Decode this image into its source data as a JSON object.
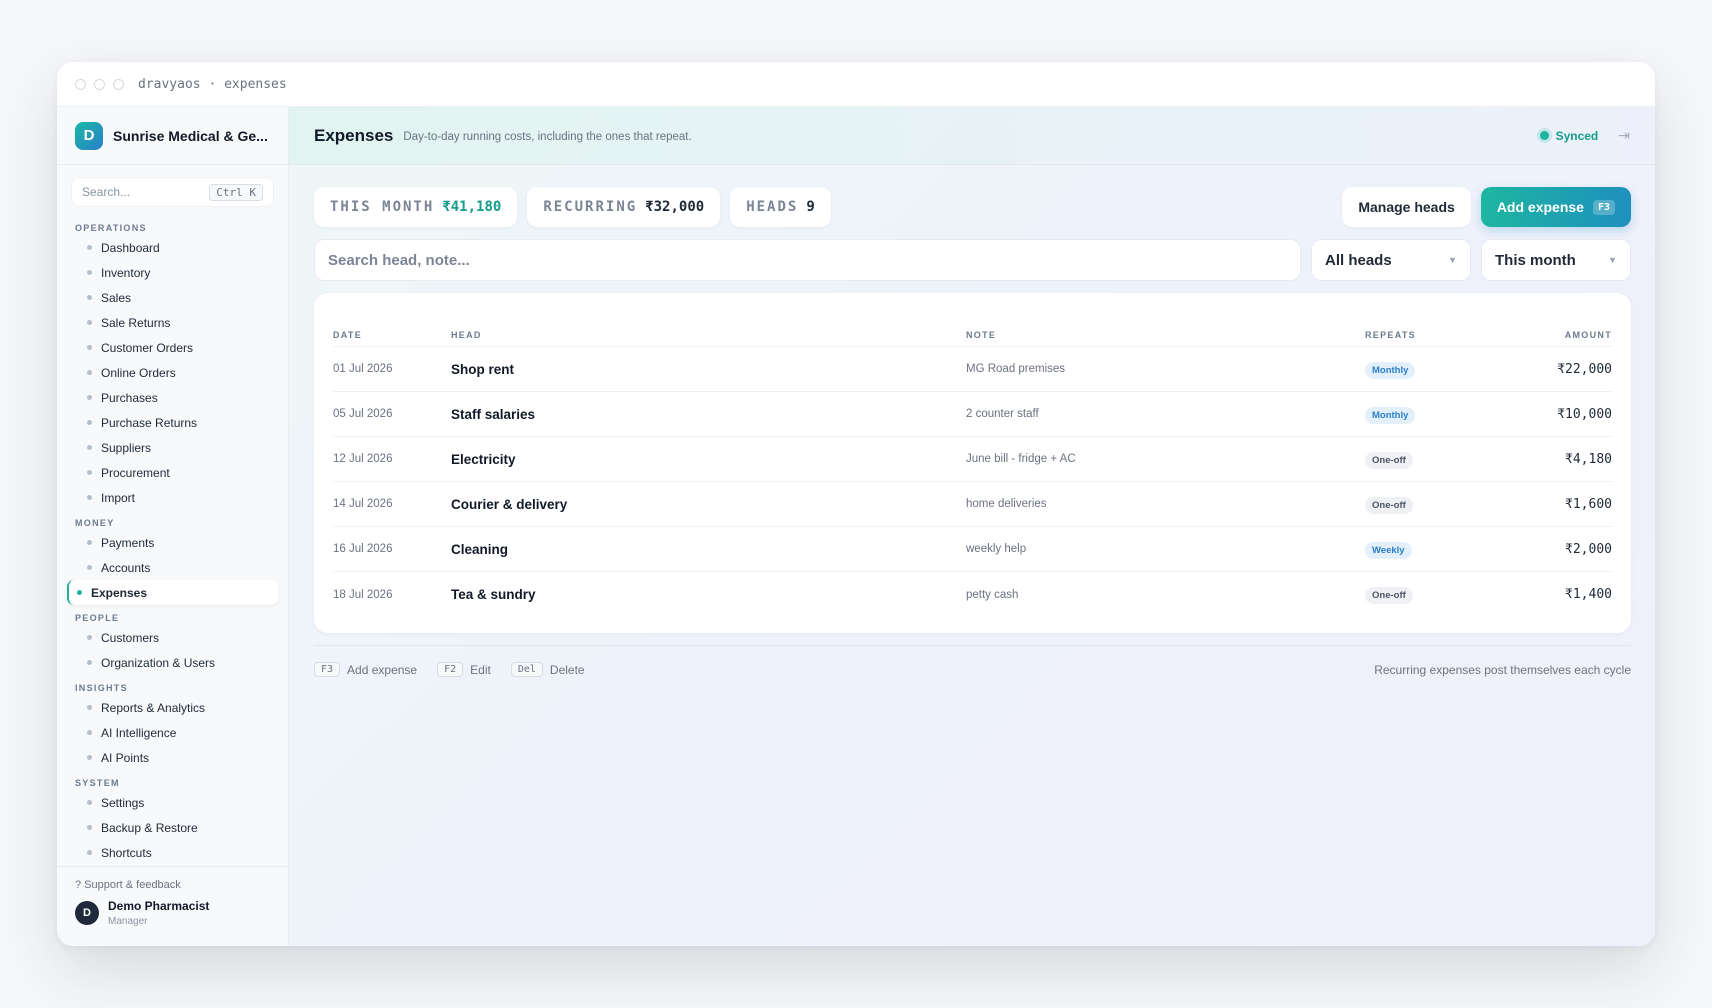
{
  "window": {
    "title": "dravyaos · expenses"
  },
  "sidebar": {
    "brand_initial": "D",
    "brand_name": "Sunrise Medical & Ge...",
    "search_placeholder": "Search...",
    "search_shortcut": "Ctrl K",
    "sections": [
      {
        "title": "OPERATIONS",
        "items": [
          "Dashboard",
          "Inventory",
          "Sales",
          "Sale Returns",
          "Customer Orders",
          "Online Orders",
          "Purchases",
          "Purchase Returns",
          "Suppliers",
          "Procurement",
          "Import"
        ]
      },
      {
        "title": "MONEY",
        "items": [
          "Payments",
          "Accounts",
          "Expenses"
        ]
      },
      {
        "title": "PEOPLE",
        "items": [
          "Customers",
          "Organization & Users"
        ]
      },
      {
        "title": "INSIGHTS",
        "items": [
          "Reports & Analytics",
          "AI Intelligence",
          "AI Points"
        ]
      },
      {
        "title": "SYSTEM",
        "items": [
          "Settings",
          "Backup & Restore",
          "Shortcuts"
        ]
      }
    ],
    "active_item": "Expenses",
    "support_link": "? Support & feedback",
    "user": {
      "initial": "D",
      "name": "Demo Pharmacist",
      "role": "Manager"
    }
  },
  "header": {
    "title": "Expenses",
    "subtitle": "Day-to-day running costs, including the ones that repeat.",
    "sync_status": "Synced"
  },
  "stats": {
    "this_month_label": "THIS MONTH",
    "this_month_value": "₹41,180",
    "recurring_label": "RECURRING",
    "recurring_value": "₹32,000",
    "heads_label": "HEADS",
    "heads_value": "9"
  },
  "actions": {
    "manage_heads": "Manage heads",
    "add_expense": "Add expense",
    "add_expense_shortcut": "F3"
  },
  "filters": {
    "search_placeholder": "Search head, note...",
    "heads_selected": "All heads",
    "period_selected": "This month"
  },
  "table": {
    "columns": {
      "date": "DATE",
      "head": "HEAD",
      "note": "NOTE",
      "repeats": "REPEATS",
      "amount": "AMOUNT"
    },
    "rows": [
      {
        "date": "01 Jul 2026",
        "head": "Shop rent",
        "note": "MG Road premises",
        "repeats": "Monthly",
        "amount": "₹22,000"
      },
      {
        "date": "05 Jul 2026",
        "head": "Staff salaries",
        "note": "2 counter staff",
        "repeats": "Monthly",
        "amount": "₹10,000"
      },
      {
        "date": "12 Jul 2026",
        "head": "Electricity",
        "note": "June bill - fridge + AC",
        "repeats": "One-off",
        "amount": "₹4,180"
      },
      {
        "date": "14 Jul 2026",
        "head": "Courier & delivery",
        "note": "home deliveries",
        "repeats": "One-off",
        "amount": "₹1,600"
      },
      {
        "date": "16 Jul 2026",
        "head": "Cleaning",
        "note": "weekly help",
        "repeats": "Weekly",
        "amount": "₹2,000"
      },
      {
        "date": "18 Jul 2026",
        "head": "Tea & sundry",
        "note": "petty cash",
        "repeats": "One-off",
        "amount": "₹1,400"
      }
    ]
  },
  "footer": {
    "hints": [
      {
        "key": "F3",
        "label": "Add expense"
      },
      {
        "key": "F2",
        "label": "Edit"
      },
      {
        "key": "Del",
        "label": "Delete"
      }
    ],
    "note": "Recurring expenses post themselves each cycle"
  },
  "colors": {
    "accent": "#1bb39e",
    "accent_blue": "#1f8fbf",
    "badge_blue": "#2a7fc9"
  }
}
